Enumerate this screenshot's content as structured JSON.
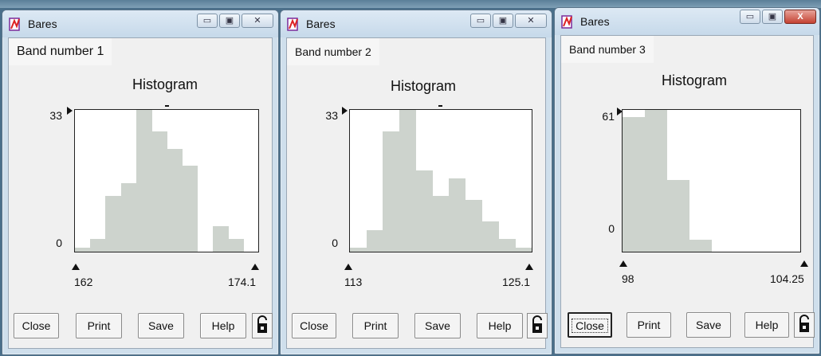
{
  "windows": [
    {
      "title": "Bares",
      "band_label": "Band number 1",
      "histogram_title": "Histogram",
      "y_max_label": "33",
      "y_min_label": "0",
      "x_min_label": "162",
      "x_max_label": "174.1",
      "buttons": {
        "close": "Close",
        "print": "Print",
        "save": "Save",
        "help": "Help"
      },
      "caption": {
        "minimize": "▭",
        "maximize": "▣",
        "close": "✕"
      },
      "chart_data": {
        "type": "bar",
        "title": "Histogram",
        "xlim": [
          162,
          174.1
        ],
        "ylim": [
          0,
          33
        ],
        "values": [
          1,
          3,
          13,
          16,
          33,
          28,
          24,
          20,
          0,
          6,
          3,
          0
        ]
      }
    },
    {
      "title": "Bares",
      "band_label": "Band number 2",
      "histogram_title": "Histogram",
      "y_max_label": "33",
      "y_min_label": "0",
      "x_min_label": "113",
      "x_max_label": "125.1",
      "buttons": {
        "close": "Close",
        "print": "Print",
        "save": "Save",
        "help": "Help"
      },
      "caption": {
        "minimize": "▭",
        "maximize": "▣",
        "close": "✕"
      },
      "chart_data": {
        "type": "bar",
        "title": "Histogram",
        "xlim": [
          113,
          125.1
        ],
        "ylim": [
          0,
          33
        ],
        "values": [
          1,
          5,
          28,
          33,
          19,
          13,
          17,
          12,
          7,
          3,
          1
        ]
      }
    },
    {
      "title": "Bares",
      "band_label": "Band number 3",
      "histogram_title": "Histogram",
      "y_max_label": "61",
      "y_min_label": "0",
      "x_min_label": "98",
      "x_max_label": "104.25",
      "buttons": {
        "close": "Close",
        "print": "Print",
        "save": "Save",
        "help": "Help"
      },
      "caption": {
        "minimize": "▭",
        "maximize": "▣",
        "close": "X"
      },
      "chart_data": {
        "type": "bar",
        "title": "Histogram",
        "xlim": [
          98,
          104.25
        ],
        "ylim": [
          0,
          61
        ],
        "values": [
          58,
          61,
          31,
          5,
          0,
          0,
          0,
          0
        ]
      }
    }
  ]
}
